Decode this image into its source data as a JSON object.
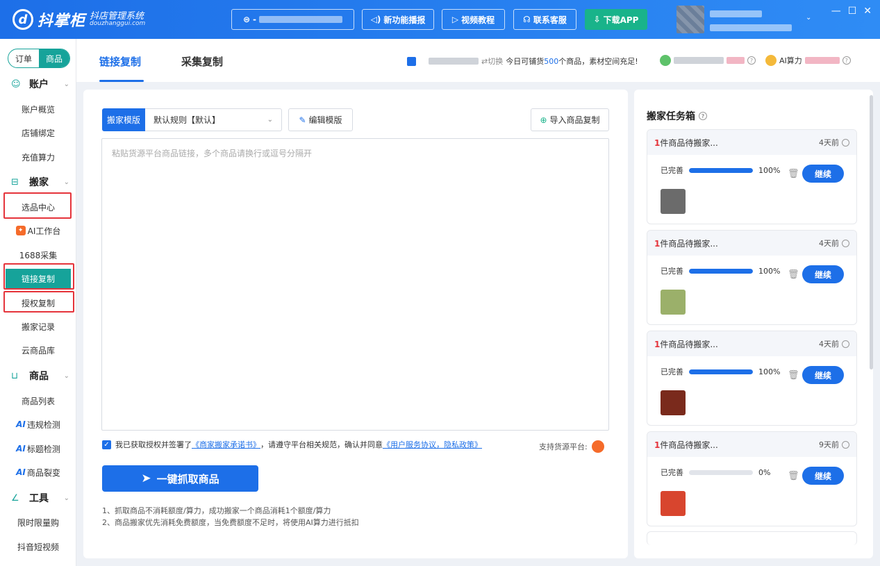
{
  "app": {
    "logo_letter": "d",
    "name": "抖掌柜",
    "subtitle": "抖店管理系统",
    "domain": "douzhanggui.com"
  },
  "topbar": {
    "shop_prefix": "-",
    "buttons": {
      "new_feature": "新功能播报",
      "video": "视频教程",
      "service": "联系客服",
      "download": "下载APP"
    },
    "icons": {
      "new_feature": "speaker-icon",
      "video": "video-icon",
      "service": "headset-icon",
      "download": "download-icon"
    }
  },
  "sidebar": {
    "seg_order": "订单",
    "seg_product": "商品",
    "group_account": "账户",
    "account_items": [
      "账户概览",
      "店铺绑定",
      "充值算力"
    ],
    "group_move": "搬家",
    "move_items": [
      "选品中心",
      "AI工作台",
      "1688采集",
      "链接复制",
      "授权复制",
      "搬家记录",
      "云商品库"
    ],
    "group_goods": "商品",
    "goods_items": [
      "商品列表",
      "违规检测",
      "标题检测",
      "商品裂变"
    ],
    "group_tools": "工具",
    "tool_items": [
      "限时限量购",
      "抖音短视频"
    ],
    "ai_label": "AI"
  },
  "tabs": {
    "link_copy": "链接复制",
    "collect_copy": "采集复制"
  },
  "header": {
    "switch_label": "切换",
    "notice_prefix": "今日可铺货",
    "notice_count": "500",
    "notice_suffix": "个商品，素材空间充足!",
    "ai_power": "AI算力"
  },
  "form": {
    "template_label": "搬家模版",
    "template_value": "默认规则【默认】",
    "edit_template": "编辑模版",
    "import_copy": "导入商品复制",
    "placeholder": "粘贴货源平台商品链接，多个商品请换行或逗号分隔开",
    "agree_a": "我已获取授权并签署了",
    "agree_link1": "《商家搬家承诺书》",
    "agree_b": "，请遵守平台相关规范，确认并同意",
    "agree_link2": "《用户服务协议，隐私政策》",
    "support_label": "支持货源平台:",
    "grab_button": "一键抓取商品",
    "note1": "1、抓取商品不消耗额度/算力，成功搬家一个商品消耗1个额度/算力",
    "note2": "2、商品搬家优先消耗免费额度，当免费额度不足时，将使用AI算力进行抵扣"
  },
  "taskbox": {
    "title": "搬家任务箱",
    "tasks": [
      {
        "count": "1",
        "text": "件商品待搬家...",
        "time": "4天前",
        "status": "已完善",
        "progress": 100,
        "percent": "100%",
        "action": "继续",
        "thumb_color": "#6b6b6b"
      },
      {
        "count": "1",
        "text": "件商品待搬家...",
        "time": "4天前",
        "status": "已完善",
        "progress": 100,
        "percent": "100%",
        "action": "继续",
        "thumb_color": "#9bb06a"
      },
      {
        "count": "1",
        "text": "件商品待搬家...",
        "time": "4天前",
        "status": "已完善",
        "progress": 100,
        "percent": "100%",
        "action": "继续",
        "thumb_color": "#7a2a1c"
      },
      {
        "count": "1",
        "text": "件商品待搬家...",
        "time": "9天前",
        "status": "已完善",
        "progress": 0,
        "percent": "0%",
        "action": "继续",
        "thumb_color": "#d8452e"
      }
    ]
  },
  "colors": {
    "primary": "#1d6fe8",
    "teal": "#16a39a",
    "highlight": "#e5343b"
  }
}
